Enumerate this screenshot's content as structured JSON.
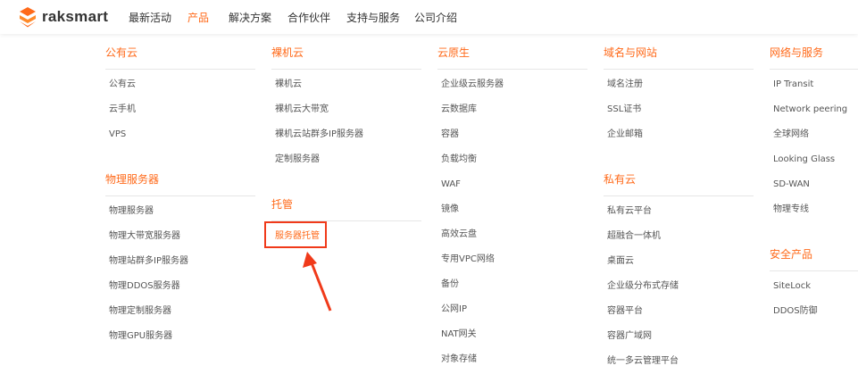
{
  "header": {
    "logo": "raksmart",
    "nav": [
      {
        "label": "最新活动",
        "active": false
      },
      {
        "label": "产品",
        "active": true
      },
      {
        "label": "解决方案",
        "active": false
      },
      {
        "label": "合作伙伴",
        "active": false
      },
      {
        "label": "支持与服务",
        "active": false
      },
      {
        "label": "公司介绍",
        "active": false
      }
    ]
  },
  "menu": {
    "public_cloud": {
      "title": "公有云",
      "items": [
        "公有云",
        "云手机",
        "VPS"
      ]
    },
    "physical": {
      "title": "物理服务器",
      "items": [
        "物理服务器",
        "物理大带宽服务器",
        "物理站群多IP服务器",
        "物理DDOS服务器",
        "物理定制服务器",
        "物理GPU服务器"
      ]
    },
    "bare_metal": {
      "title": "裸机云",
      "items": [
        "裸机云",
        "裸机云大带宽",
        "裸机云站群多IP服务器",
        "定制服务器"
      ]
    },
    "hosting": {
      "title": "托管",
      "items": [
        "服务器托管"
      ]
    },
    "cloud_native": {
      "title": "云原生",
      "items": [
        "企业级云服务器",
        "云数据库",
        "容器",
        "负载均衡",
        "WAF",
        "镜像",
        "高效云盘",
        "专用VPC网络",
        "备份",
        "公网IP",
        "NAT网关",
        "对象存储"
      ]
    },
    "domain": {
      "title": "域名与网站",
      "items": [
        "域名注册",
        "SSL证书",
        "企业邮箱"
      ]
    },
    "private_cloud": {
      "title": "私有云",
      "items": [
        "私有云平台",
        "超融合一体机",
        "桌面云",
        "企业级分布式存储",
        "容器平台",
        "容器广域网",
        "统一多云管理平台"
      ]
    },
    "network": {
      "title": "网络与服务",
      "items": [
        "IP Transit",
        "Network peering",
        "全球网络",
        "Looking Glass",
        "SD-WAN",
        "物理专线"
      ]
    },
    "security": {
      "title": "安全产品",
      "items": [
        "SiteLock",
        "DDOS防御"
      ]
    }
  },
  "colors": {
    "accent": "#ff6a1a",
    "annotation": "#f03a1a"
  }
}
